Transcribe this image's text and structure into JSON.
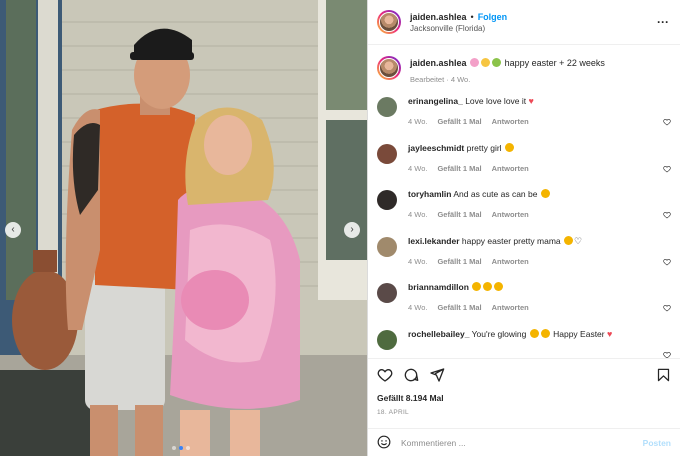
{
  "header": {
    "username": "jaiden.ashlea",
    "separator": "•",
    "follow_label": "Folgen",
    "location": "Jacksonville (Florida)",
    "more_icon": "more-horizontal-icon"
  },
  "caption": {
    "username": "jaiden.ashlea",
    "text": "happy easter + 22 weeks",
    "meta": "Bearbeitet · 4 Wo."
  },
  "comments": [
    {
      "username": "erinangelina_",
      "text": "Love love love it",
      "time": "4 Wo.",
      "likes": "Gefällt 1 Mal",
      "reply": "Antworten",
      "avatar_color": "#6b7a62"
    },
    {
      "username": "jayleeschmidt",
      "text": "pretty girl",
      "time": "4 Wo.",
      "likes": "Gefällt 1 Mal",
      "reply": "Antworten",
      "avatar_color": "#7a4a3a"
    },
    {
      "username": "toryhamlin",
      "text": "And as cute as can be",
      "time": "4 Wo.",
      "likes": "Gefällt 1 Mal",
      "reply": "Antworten",
      "avatar_color": "#2f2a28"
    },
    {
      "username": "lexi.lekander",
      "text": "happy easter pretty mama",
      "time": "4 Wo.",
      "likes": "Gefällt 1 Mal",
      "reply": "Antworten",
      "avatar_color": "#a08a6c"
    },
    {
      "username": "briannamdillon",
      "text": "",
      "time": "4 Wo.",
      "likes": "Gefällt 1 Mal",
      "reply": "Antworten",
      "avatar_color": "#5a4a48"
    },
    {
      "username": "rochellebailey_",
      "text": "You're glowing",
      "trailing": "Happy Easter",
      "time": "4 Wo.",
      "likes": "Gefällt 1 Mal",
      "reply": "Antworten",
      "avatar_color": "#4f6b3f"
    }
  ],
  "likes_text": "Gefällt 8.194 Mal",
  "date_text": "18. APRIL",
  "compose": {
    "placeholder": "Kommentieren ...",
    "post_label": "Posten"
  },
  "carousel": {
    "prev_icon": "chevron-left-icon",
    "next_icon": "chevron-right-icon",
    "slide_count": 3,
    "active_slide": 2
  },
  "colors": {
    "accent": "#0095f6",
    "post_disabled": "#b2dffc",
    "heart_red": "#ed4956"
  }
}
